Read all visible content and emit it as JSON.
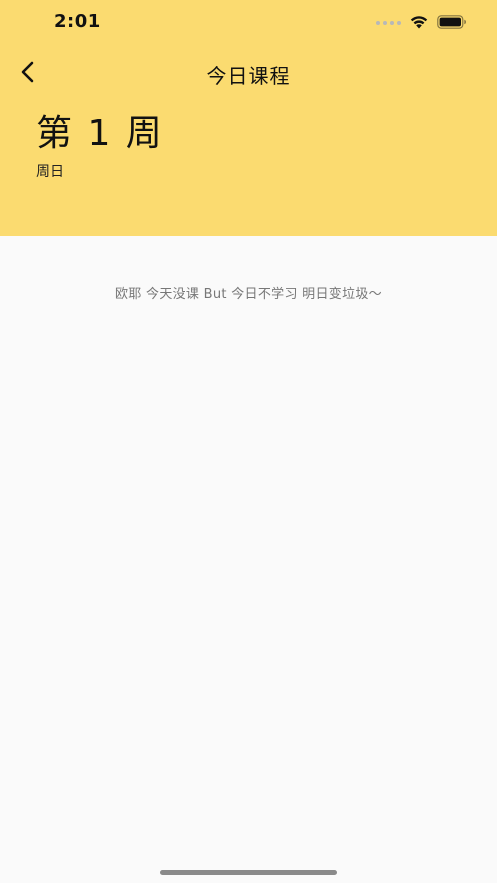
{
  "status_bar": {
    "time": "2:01",
    "signal_icon": "cellular-signal-icon",
    "wifi_icon": "wifi-icon",
    "battery_icon": "battery-icon"
  },
  "nav": {
    "back_icon": "chevron-left-icon",
    "title": "今日课程"
  },
  "header": {
    "week_title": "第 1 周",
    "day_label": "周日",
    "background_color": "#fbdb70"
  },
  "content": {
    "empty_message": "欧耶 今天没课 But 今日不学习 明日变垃圾～"
  }
}
